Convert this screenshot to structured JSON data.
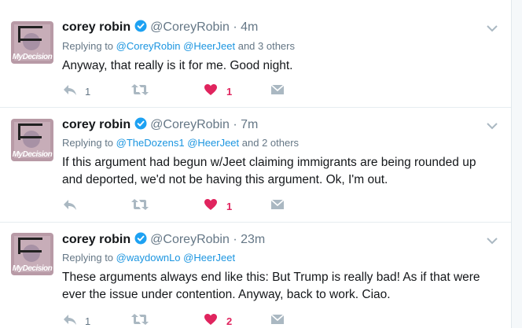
{
  "tweets": [
    {
      "avatar_text": "MyDecision",
      "name": "corey robin",
      "handle": "@CoreyRobin",
      "dot": "·",
      "time": "4m",
      "replying_prefix": "Replying to",
      "replying_links": [
        "@CoreyRobin",
        "@HeerJeet"
      ],
      "replying_suffix": "and 3 others",
      "text": "Anyway, that really is it for me. Good night.",
      "reply_count": "1",
      "retweet_count": "",
      "like_count": "1"
    },
    {
      "avatar_text": "MyDecision",
      "name": "corey robin",
      "handle": "@CoreyRobin",
      "dot": "·",
      "time": "7m",
      "replying_prefix": "Replying to",
      "replying_links": [
        "@TheDozens1",
        "@HeerJeet"
      ],
      "replying_suffix": "and 2 others",
      "text": "If this argument had begun w/Jeet claiming immigrants are being rounded up and deported, we'd not be having this argument. Ok, I'm out.",
      "reply_count": "",
      "retweet_count": "",
      "like_count": "1"
    },
    {
      "avatar_text": "MyDecision",
      "name": "corey robin",
      "handle": "@CoreyRobin",
      "dot": "·",
      "time": "23m",
      "replying_prefix": "Replying to",
      "replying_links": [
        "@waydownLo",
        "@HeerJeet"
      ],
      "replying_suffix": "",
      "text": "These arguments always end like this: But Trump is really bad! As if that were ever the issue under contention. Anyway, back to work. Ciao.",
      "reply_count": "1",
      "retweet_count": "",
      "like_count": "2"
    }
  ],
  "colors": {
    "link": "#1b95e0",
    "verified": "#1da1f2",
    "like": "#e0245e",
    "muted": "#657786",
    "icon": "#aab8c2"
  },
  "icons": [
    "verified-badge-icon",
    "chevron-down-icon",
    "reply-icon",
    "retweet-icon",
    "heart-icon",
    "dm-envelope-icon"
  ]
}
